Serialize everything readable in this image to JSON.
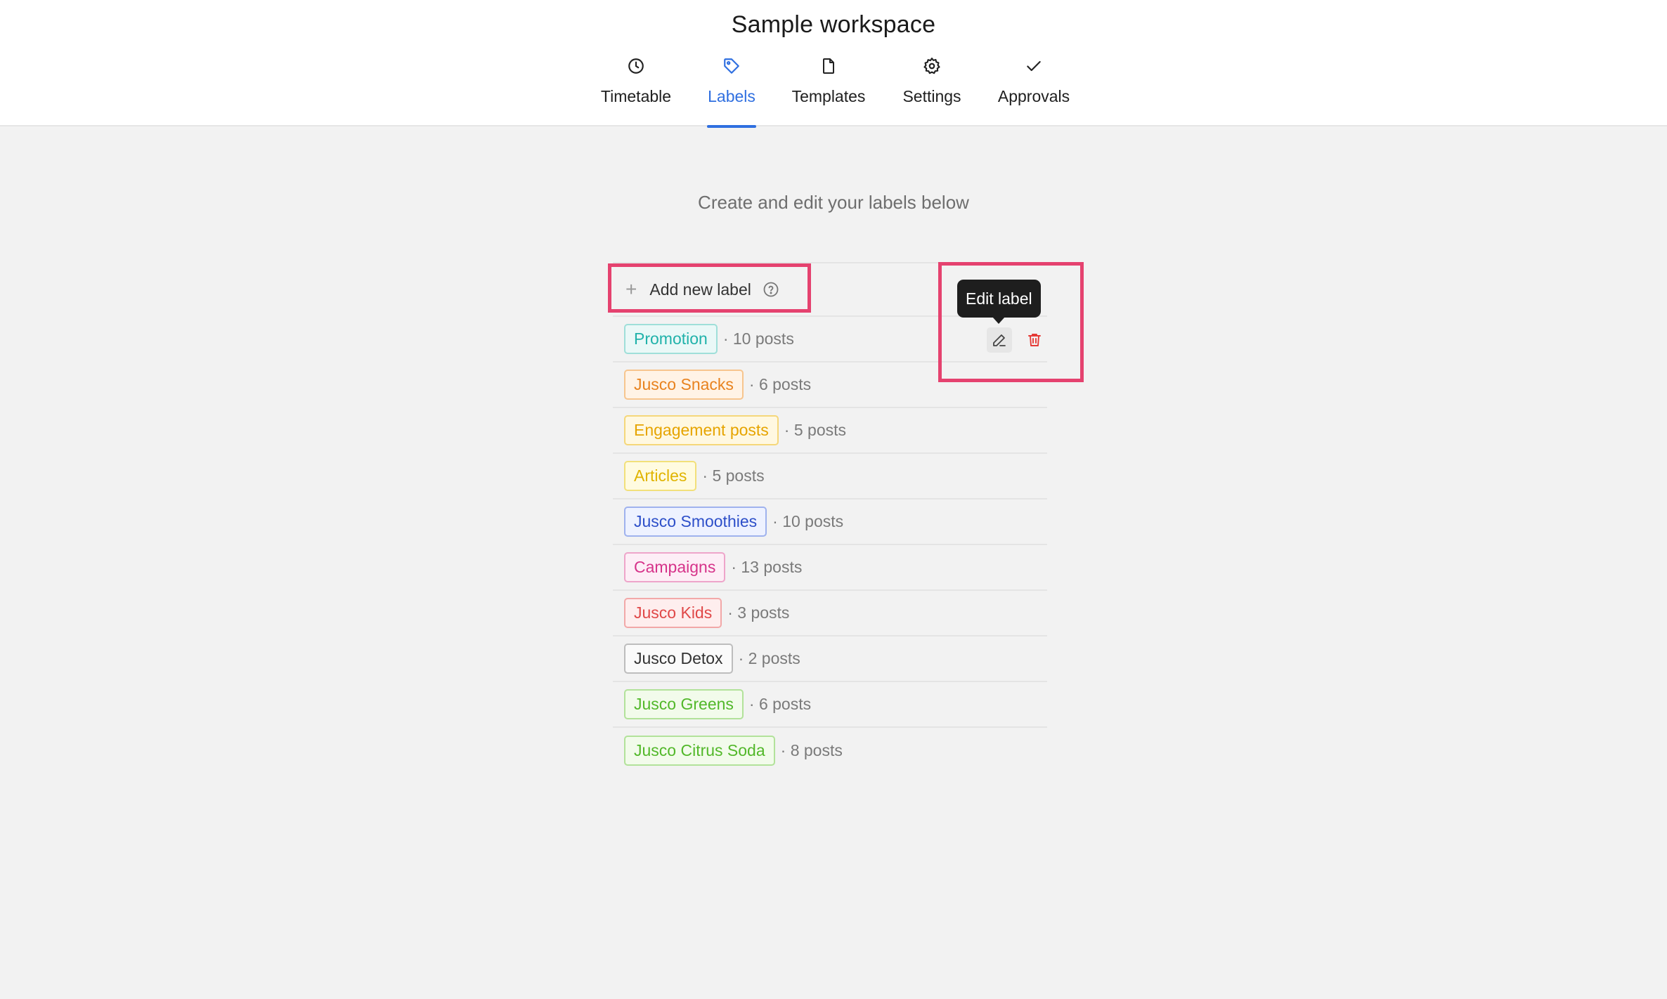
{
  "workspace": {
    "title": "Sample workspace"
  },
  "tabs": [
    {
      "label": "Timetable",
      "icon": "clock-icon",
      "active": false
    },
    {
      "label": "Labels",
      "icon": "tag-icon",
      "active": true
    },
    {
      "label": "Templates",
      "icon": "file-icon",
      "active": false
    },
    {
      "label": "Settings",
      "icon": "gear-icon",
      "active": false
    },
    {
      "label": "Approvals",
      "icon": "check-icon",
      "active": false
    }
  ],
  "main": {
    "subtitle": "Create and edit your labels below",
    "add_label": "Add new label",
    "tooltip": "Edit label"
  },
  "labels": [
    {
      "name": "Promotion",
      "count": "· 10 posts",
      "color": "#20b2aa",
      "bg": "#eaf8f7",
      "border": "#9fdfd9"
    },
    {
      "name": "Jusco Snacks",
      "count": "· 6 posts",
      "color": "#e8821e",
      "bg": "#fff3e6",
      "border": "#f7c58e"
    },
    {
      "name": "Engagement posts",
      "count": "· 5 posts",
      "color": "#e6a400",
      "bg": "#fff8e1",
      "border": "#f5d77a"
    },
    {
      "name": "Articles",
      "count": "· 5 posts",
      "color": "#e0b400",
      "bg": "#fffbe0",
      "border": "#f2e07a"
    },
    {
      "name": "Jusco Smoothies",
      "count": "· 10 posts",
      "color": "#2d4fc9",
      "bg": "#eef2ff",
      "border": "#9fb2ee"
    },
    {
      "name": "Campaigns",
      "count": "· 13 posts",
      "color": "#d6338a",
      "bg": "#fdeef6",
      "border": "#eea5ca"
    },
    {
      "name": "Jusco Kids",
      "count": "· 3 posts",
      "color": "#e04848",
      "bg": "#feeeee",
      "border": "#f2a8a8"
    },
    {
      "name": "Jusco Detox",
      "count": "· 2 posts",
      "color": "#333333",
      "bg": "#fafafa",
      "border": "#bdbdbd"
    },
    {
      "name": "Jusco Greens",
      "count": "· 6 posts",
      "color": "#52b82a",
      "bg": "#f2fbeb",
      "border": "#b2e29a"
    },
    {
      "name": "Jusco Citrus Soda",
      "count": "· 8 posts",
      "color": "#52b82a",
      "bg": "#f2fbeb",
      "border": "#b2e29a"
    }
  ],
  "colors": {
    "accent": "#2f6fe0",
    "highlight": "#e5426f",
    "delete": "#e53935"
  }
}
